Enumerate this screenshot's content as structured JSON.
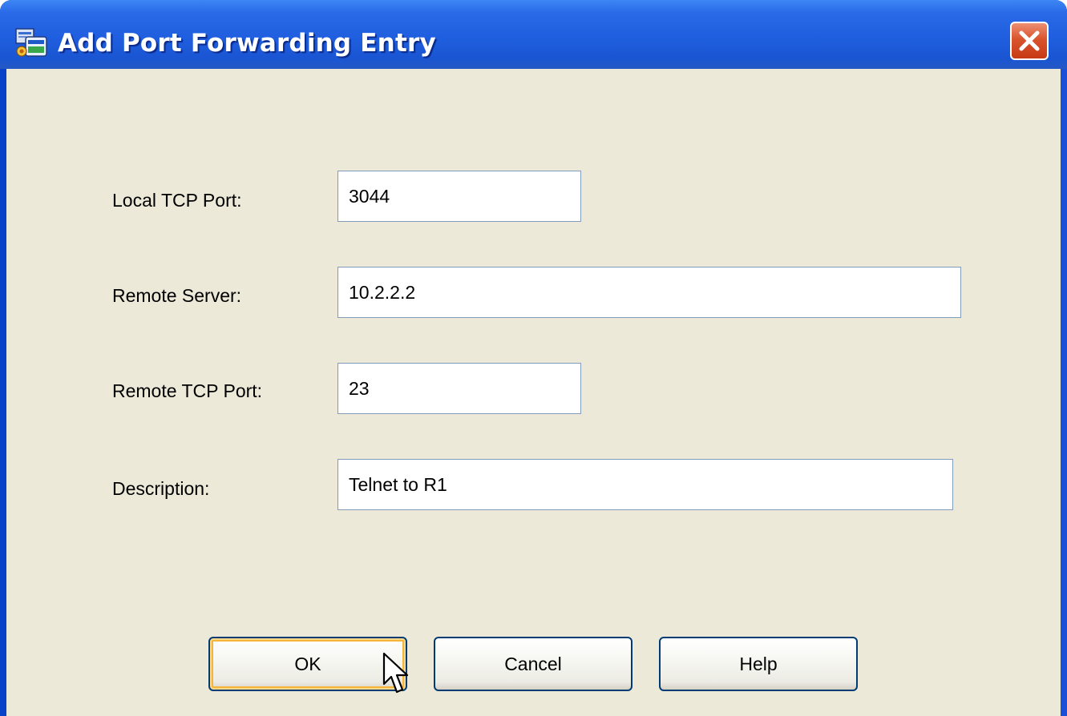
{
  "window": {
    "title": "Add Port Forwarding Entry",
    "title_color": "#ffffff",
    "titlebar_color": "#1f5fdf",
    "client_bg": "#ece9d8",
    "close_color": "#d9542d"
  },
  "icons": {
    "app": "app-icon",
    "close": "close-icon",
    "cursor": "mouse-pointer-icon"
  },
  "form": {
    "local_tcp_port": {
      "label": "Local TCP Port:",
      "value": "3044"
    },
    "remote_server": {
      "label": "Remote Server:",
      "value": "10.2.2.2"
    },
    "remote_tcp_port": {
      "label": "Remote TCP Port:",
      "value": "23"
    },
    "description": {
      "label": "Description:",
      "value": "Telnet to R1"
    }
  },
  "buttons": {
    "ok": "OK",
    "cancel": "Cancel",
    "help": "Help"
  }
}
